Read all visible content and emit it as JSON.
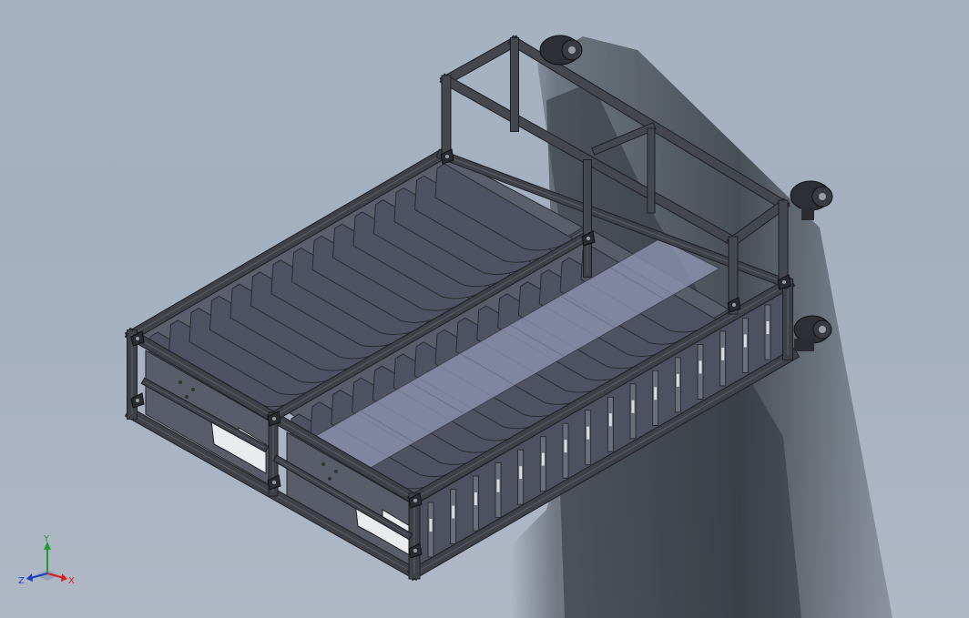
{
  "app": {
    "title": ""
  },
  "colors": {
    "background": "#a6b1c0",
    "frame": "#3f4148",
    "frame_edge": "#1e1f24",
    "divider": "#4f5262",
    "divider_edge": "#2a2b31",
    "panel": "#565a66",
    "transparent_sheet": "#8e93ad",
    "shadow": "#3a3f47",
    "axis_x": "#d81f1f",
    "axis_y": "#1e9c2c",
    "axis_z": "#1d3fbf"
  },
  "triad": {
    "x_label": "X",
    "y_label": "Y",
    "z_label": "Z"
  },
  "model": {
    "name": "",
    "icon": "cad-assembly-icon"
  }
}
